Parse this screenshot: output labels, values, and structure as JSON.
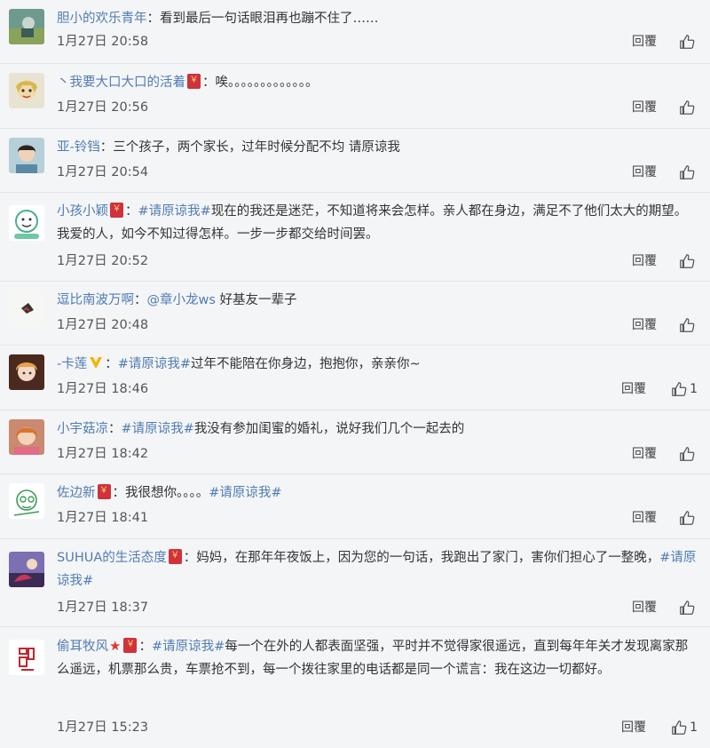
{
  "comments": [
    {
      "user": "胆小的欢乐青年",
      "sep": "：",
      "text": "看到最后一句话眼泪再也蹦不住了……",
      "time": "1月27日 20:58",
      "reply": "回覆",
      "likes": ""
    },
    {
      "user": "丶我要大口大口的活着",
      "sep": "：",
      "text": "唉。。。。。。。。。。。。。",
      "time": "1月27日 20:56",
      "reply": "回覆",
      "likes": ""
    },
    {
      "user": "亚-铃铛",
      "sep": "：",
      "text": "三个孩子，两个家长，过年时候分配不均 请原谅我",
      "time": "1月27日 20:54",
      "reply": "回覆",
      "likes": ""
    },
    {
      "user": "小孩小颖",
      "sep": "：",
      "tag": "#请原谅我#",
      "text": "现在的我还是迷茫，不知道将来会怎样。亲人都在身边，满足不了他们太大的期望。我爱的人，如今不知过得怎样。一步一步都交给时间罢。",
      "time": "1月27日 20:52",
      "reply": "回覆",
      "likes": ""
    },
    {
      "user": "逗比南波万啊",
      "sep": "：",
      "mention": "@章小龙ws",
      "text": " 好基友一辈子",
      "time": "1月27日 20:48",
      "reply": "回覆",
      "likes": ""
    },
    {
      "user": "-卡莲",
      "sep": "：",
      "tag": "#请原谅我#",
      "text": "过年不能陪在你身边，抱抱你，亲亲你~",
      "time": "1月27日 18:46",
      "reply": "回覆",
      "likes": "1"
    },
    {
      "user": "小宇菇凉",
      "sep": "：",
      "tag": "#请原谅我#",
      "text": "我没有参加闺蜜的婚礼，说好我们几个一起去的",
      "time": "1月27日 18:42",
      "reply": "回覆",
      "likes": ""
    },
    {
      "user": "佐边新",
      "sep": "：",
      "text": "我很想你。。。。",
      "tag": "#请原谅我#",
      "time": "1月27日 18:41",
      "reply": "回覆",
      "likes": ""
    },
    {
      "user": "SUHUA的生活态度",
      "sep": "：",
      "text": "妈妈，在那年年夜饭上，因为您的一句话，我跑出了家门，害你们担心了一整晚，",
      "tag": "#请原谅我#",
      "time": "1月27日 18:37",
      "reply": "回覆",
      "likes": ""
    },
    {
      "user": "偷耳牧风",
      "sep": "：",
      "tag": "#请原谅我#",
      "text": "每一个在外的人都表面坚强，平时并不觉得家很遥远，直到每年年关才发现离家那么遥远，机票那么贵，车票抢不到，每一个拨往家里的电话都是同一个谎言：我在这边一切都好。",
      "time": "1月27日 15:23",
      "reply": "回覆",
      "likes": "1"
    }
  ],
  "icons": {
    "like": "thumbs-up-icon",
    "redpack": "red-envelope-icon",
    "verified": "gold-v-badge-icon",
    "star": "red-star-icon"
  },
  "colors": {
    "background": "#f4f5f7",
    "name": "#4f7cb3",
    "text": "#333333",
    "divider": "#e3e4e7",
    "redpack": "#d0323b"
  }
}
